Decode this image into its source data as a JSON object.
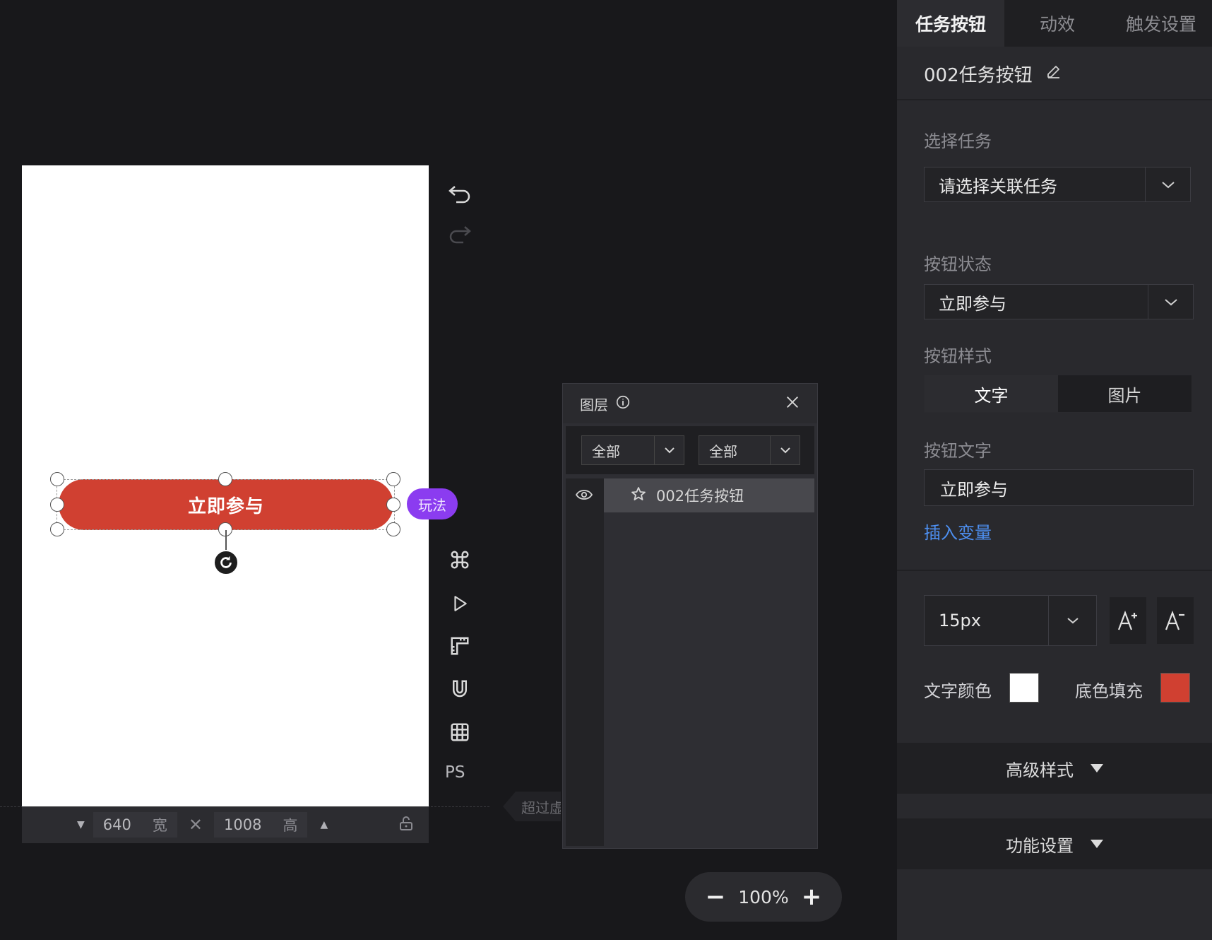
{
  "canvas": {
    "button_label": "立即参与",
    "play_badge": "玩法",
    "width_value": "640",
    "width_unit": "宽",
    "height_value": "1008",
    "height_unit": "高",
    "ps_label": "PS",
    "overflow_tip": "超过虚"
  },
  "layers": {
    "title": "图层",
    "filter1": "全部",
    "filter2": "全部",
    "items": [
      {
        "label": "002任务按钮"
      }
    ]
  },
  "zoom": {
    "value": "100%",
    "minus": "−",
    "plus": "+"
  },
  "panel": {
    "tabs": [
      {
        "label": "任务按钮"
      },
      {
        "label": "动效"
      },
      {
        "label": "触发设置"
      }
    ],
    "component_name": "002任务按钮",
    "select_task": {
      "label": "选择任务",
      "placeholder": "请选择关联任务"
    },
    "button_state": {
      "label": "按钮状态",
      "value": "立即参与"
    },
    "button_style": {
      "label": "按钮样式",
      "options": [
        "文字",
        "图片"
      ]
    },
    "button_text": {
      "label": "按钮文字",
      "value": "立即参与",
      "insert_var": "插入变量"
    },
    "font_size": "15px",
    "text_color": {
      "label": "文字颜色",
      "color": "#ffffff"
    },
    "fill_color": {
      "label": "底色填充",
      "color": "#d04031"
    },
    "advanced": "高级样式",
    "functions": "功能设置"
  }
}
